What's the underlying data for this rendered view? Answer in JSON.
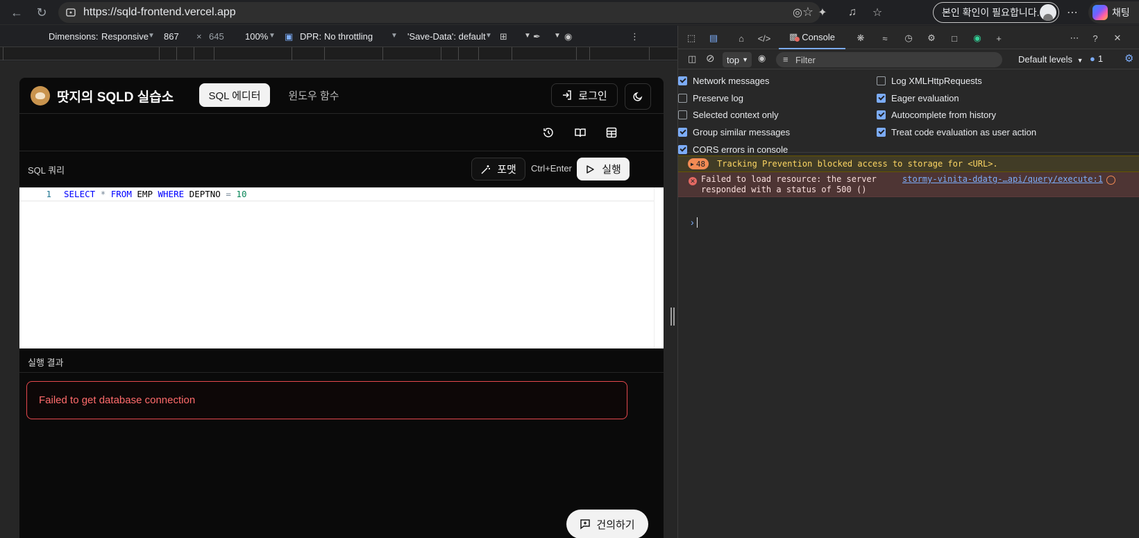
{
  "browser": {
    "url": "https://sqld-frontend.vercel.app",
    "verify_label": "본인 확인이 필요합니다.",
    "copilot_label": "채팅"
  },
  "device_toolbar": {
    "dimensions_label": "Dimensions:",
    "device": "Responsive",
    "width": "867",
    "times": "×",
    "height": "645",
    "zoom": "100%",
    "dpr_label": "DPR:",
    "throttling": "No throttling",
    "save_data": "'Save-Data': default"
  },
  "app": {
    "title": "땃지의 SQLD 실습소",
    "tabs": [
      {
        "label": "SQL 에디터",
        "active": true
      },
      {
        "label": "윈도우 함수",
        "active": false
      }
    ],
    "login_label": "로그인",
    "query_label": "SQL 쿼리",
    "format_label": "포맷",
    "shortcut": "Ctrl+Enter",
    "run_label": "실행",
    "editor": {
      "line_number": "1",
      "tokens": {
        "select": "SELECT",
        "star": "*",
        "from": "FROM",
        "table": "EMP",
        "where": "WHERE",
        "column": "DEPTNO",
        "eq": "=",
        "value": "10"
      }
    },
    "result_label": "실행 결과",
    "error_message": "Failed to get database connection",
    "suggest_label": "건의하기"
  },
  "devtools": {
    "console_tab": "Console",
    "context": "top",
    "filter_placeholder": "Filter",
    "levels": "Default levels",
    "issues_count": "1",
    "settings_left": [
      {
        "label": "Network messages",
        "checked": true
      },
      {
        "label": "Preserve log",
        "checked": false
      },
      {
        "label": "Selected context only",
        "checked": false
      },
      {
        "label": "Group similar messages",
        "checked": true
      },
      {
        "label": "CORS errors in console",
        "checked": true
      }
    ],
    "settings_right": [
      {
        "label": "Log XMLHttpRequests",
        "checked": false
      },
      {
        "label": "Eager evaluation",
        "checked": true
      },
      {
        "label": "Autocomplete from history",
        "checked": true
      },
      {
        "label": "Treat code evaluation as user action",
        "checked": true
      }
    ],
    "warning": {
      "count": "48",
      "text": "Tracking Prevention blocked access to storage for <URL>."
    },
    "error": {
      "text": "Failed to load resource: the server responded with a status of 500 ()",
      "source": "stormy-vinita-ddatg-…api/query/execute:1"
    }
  },
  "colors": {
    "accent": "#7cacf8",
    "error": "#e5484d",
    "warning_bg": "#413c26",
    "error_bg": "#4e3534"
  }
}
